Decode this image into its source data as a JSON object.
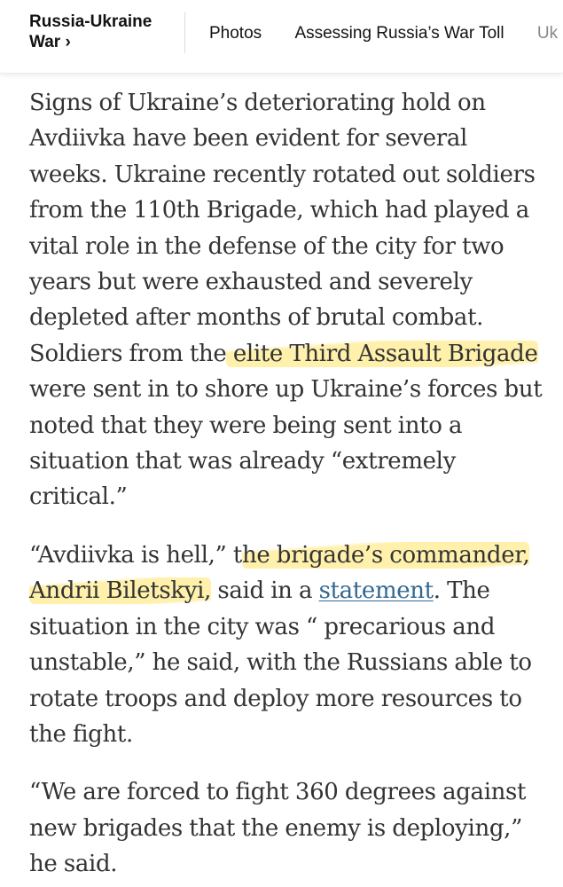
{
  "nav": {
    "section": "Russia-Ukraine War ›",
    "tabs": [
      "Photos",
      "Assessing Russia’s War Toll",
      "Uk"
    ]
  },
  "article": {
    "p1": {
      "before": "Signs of Ukraine’s deteriorating hold on Avdiivka have been evident for several weeks. Ukraine recently rotated out soldiers from the 110th Brigade, which had played a vital role in the defense of the city for two years but were exhausted and severely depleted after months of brutal combat. Soldiers from the",
      "highlight": " elite Third Assault Brigade ",
      "after": "were sent in to shore up Ukraine’s forces but noted that they were being sent into a situation that was already “extremely critical.”"
    },
    "p2": {
      "before": "“Avdiivka is hell,” t",
      "highlight": "he brigade’s commander, Andrii Biletskyi,",
      "middle": " said in a ",
      "link": "statement",
      "after": ". The situation in the city was “ precarious and unstable,” he said, with the Russians able to rotate troops and deploy more resources to the fight."
    },
    "p3": {
      "text": "“We are forced to fight 360 degrees against new brigades that the enemy is deploying,” he said."
    }
  },
  "colors": {
    "highlight": "#ffe778",
    "link": "#326891",
    "body_text": "#333333"
  }
}
